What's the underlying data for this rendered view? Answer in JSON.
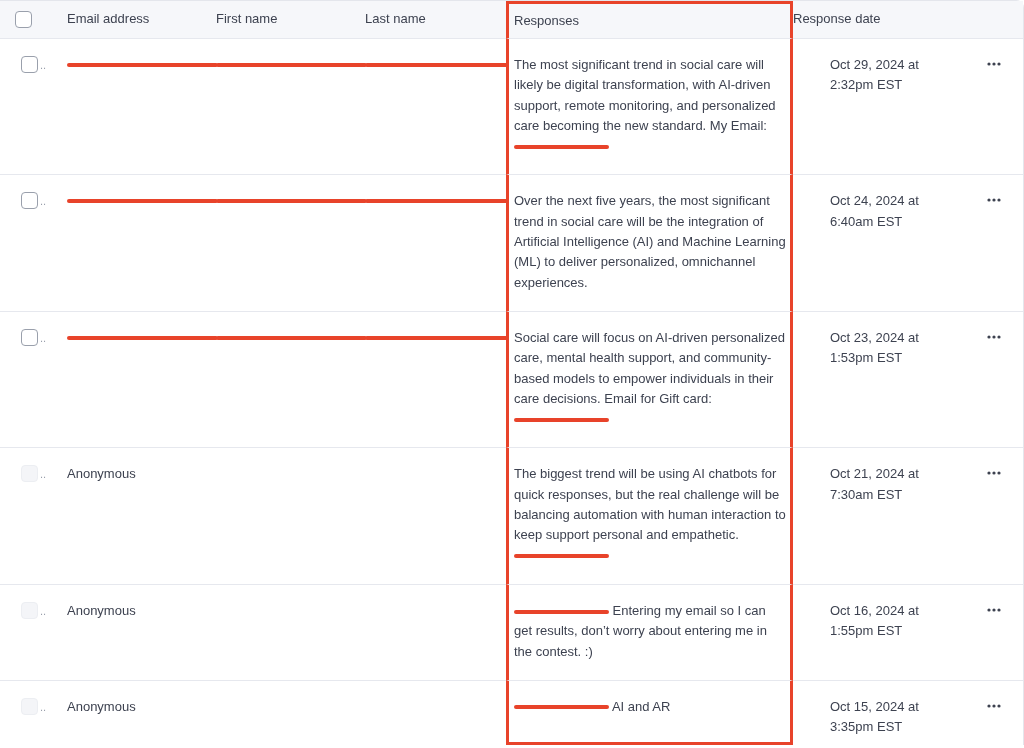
{
  "table": {
    "header_checkbox": {
      "checked": false,
      "disabled": false
    },
    "columns": [
      {
        "label": "Email address",
        "highlighted": false
      },
      {
        "label": "First name",
        "highlighted": false
      },
      {
        "label": "Last name",
        "highlighted": false
      },
      {
        "label": "Responses",
        "highlighted": true
      },
      {
        "label": "Response date",
        "highlighted": false
      }
    ],
    "rows": [
      {
        "checkbox": {
          "checked": false,
          "disabled": false
        },
        "checkbox_suffix": "..",
        "email": {
          "redacted": true
        },
        "first_name": {
          "redacted": true
        },
        "last_name": {
          "redacted": true
        },
        "response": [
          {
            "kind": "text",
            "text": "The most significant trend in social care will likely be digital transformation, with AI-driven support, remote monitoring, and personalized care becoming the new standard. My Email: "
          },
          {
            "kind": "redacted"
          }
        ],
        "date": "Oct 29, 2024 at 2:32pm EST"
      },
      {
        "checkbox": {
          "checked": false,
          "disabled": false
        },
        "checkbox_suffix": "..",
        "email": {
          "redacted": true
        },
        "first_name": {
          "redacted": true
        },
        "last_name": {
          "redacted": true
        },
        "response": [
          {
            "kind": "text",
            "text": "Over the next five years, the most significant trend in social care will be the integration of Artificial Intelligence (AI) and Machine Learning (ML) to deliver personalized, omnichannel experiences."
          }
        ],
        "date": "Oct 24, 2024 at 6:40am EST"
      },
      {
        "checkbox": {
          "checked": false,
          "disabled": false
        },
        "checkbox_suffix": "..",
        "email": {
          "redacted": true
        },
        "first_name": {
          "redacted": true
        },
        "last_name": {
          "redacted": true
        },
        "response": [
          {
            "kind": "text",
            "text": "Social care will focus on AI-driven personalized care, mental health support, and community-based models to empower individuals in their care decisions. Email for Gift card: "
          },
          {
            "kind": "redacted"
          }
        ],
        "date": "Oct 23, 2024 at 1:53pm EST"
      },
      {
        "checkbox": {
          "checked": false,
          "disabled": true
        },
        "checkbox_suffix": "..",
        "email": {
          "text": "Anonymous"
        },
        "response": [
          {
            "kind": "text",
            "text": "The biggest trend will be using AI chatbots for quick responses, but the real challenge will be balancing automation with human interaction to keep support personal and empathetic. "
          },
          {
            "kind": "redacted"
          }
        ],
        "date": "Oct 21, 2024 at 7:30am EST"
      },
      {
        "checkbox": {
          "checked": false,
          "disabled": true
        },
        "checkbox_suffix": "..",
        "email": {
          "text": "Anonymous"
        },
        "response": [
          {
            "kind": "redacted"
          },
          {
            "kind": "text",
            "text": " Entering my email so I can get results, don’t worry about entering me in the contest. :)"
          }
        ],
        "date": "Oct 16, 2024 at 1:55pm EST"
      },
      {
        "checkbox": {
          "checked": false,
          "disabled": true
        },
        "checkbox_suffix": "..",
        "email": {
          "text": "Anonymous"
        },
        "response": [
          {
            "kind": "redacted"
          },
          {
            "kind": "text",
            "text": " AI and AR"
          }
        ],
        "date": "Oct 15, 2024 at 3:35pm EST"
      }
    ]
  }
}
